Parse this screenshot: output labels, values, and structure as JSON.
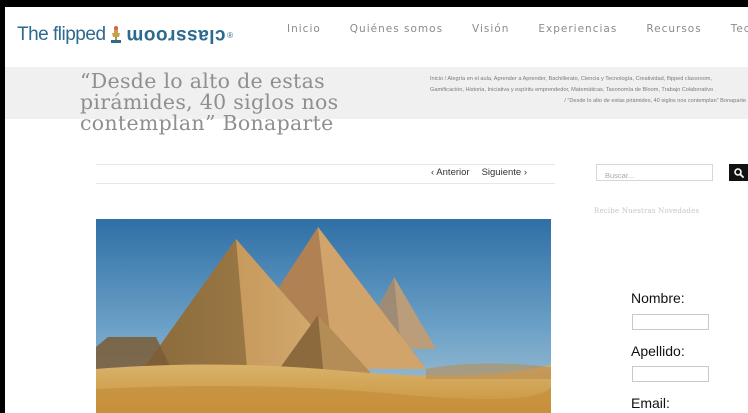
{
  "header": {
    "logo": {
      "part1": "The flipped",
      "part2": "classroom",
      "tm": "®",
      "icon": "trophy-icon"
    },
    "nav": [
      "Inicio",
      "Quiénes somos",
      "Visión",
      "Experiencias",
      "Recursos",
      "Tecnología y FC"
    ]
  },
  "titlebar": {
    "title": "“Desde lo alto de estas pirámides, 40 siglos nos contemplan” Bonaparte",
    "breadcrumb": {
      "line1": "Inicio / Alegría en el aula, Aprender a Aprender, Bachillerato, Ciencia y Tecnología, Creatividad, flipped classroom,",
      "line2": "Gamificación, Historia, Iniciativa y espíritu emprendedor, Matemáticas, Taxonomía de Bloom, Trabajo Colaborativo",
      "line3": "/ “Desde lo alto de estas pirámides, 40 siglos nos contemplan” Bonaparte"
    }
  },
  "post_nav": {
    "prev": "‹ Anterior",
    "next": "Siguiente ›"
  },
  "featured_image": {
    "subject": "Pirámides de Giza"
  },
  "sidebar": {
    "search_placeholder": "Buscar...",
    "search_icon": "search-icon",
    "newsletter_heading": "Recibe Nuestras Novedades",
    "form": {
      "nombre": "Nombre:",
      "apellido": "Apellido:",
      "email": "Email:"
    }
  },
  "colors": {
    "logo_blue": "#2c6a8e",
    "titlebar_bg": "#f0f0f0",
    "nav_text": "#8b8b8b",
    "search_button": "#111111"
  }
}
